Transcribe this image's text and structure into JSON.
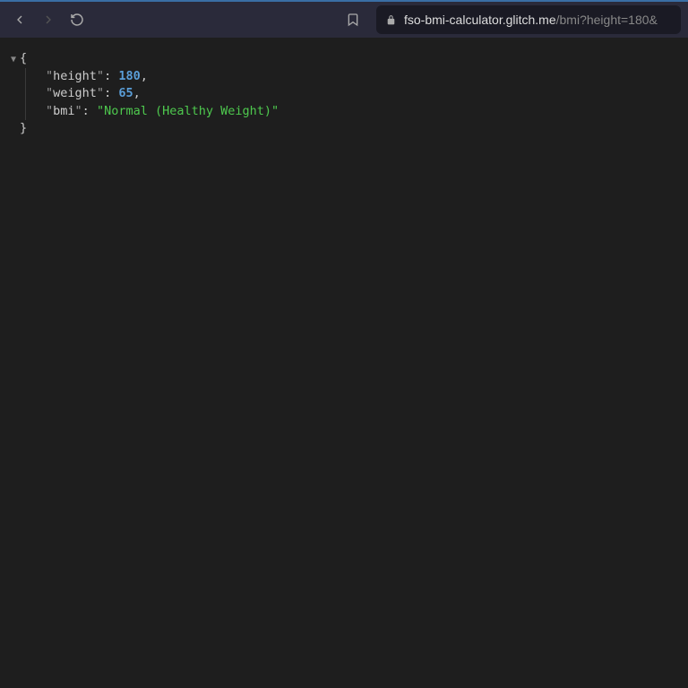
{
  "toolbar": {
    "url_host": "fso-bmi-calculator.glitch.me",
    "url_path": "/bmi?height=180&"
  },
  "json": {
    "open_brace": "{",
    "close_brace": "}",
    "toggle_glyph": "▼",
    "entries": [
      {
        "key": "height",
        "value": "180",
        "type": "number",
        "trailing_comma": ","
      },
      {
        "key": "weight",
        "value": "65",
        "type": "number",
        "trailing_comma": ","
      },
      {
        "key": "bmi",
        "value": "Normal (Healthy Weight)",
        "type": "string",
        "trailing_comma": ""
      }
    ]
  }
}
